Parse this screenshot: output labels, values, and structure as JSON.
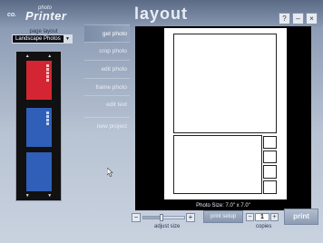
{
  "app": {
    "logo_brand": "co.",
    "logo_small": "photo",
    "logo_main": "Printer",
    "page_title": "layout"
  },
  "window_controls": {
    "help": "?",
    "minimize": "–",
    "close": "×"
  },
  "left_panel": {
    "label": "page layout",
    "select_value": "Landscape Photos",
    "select_arrow": "▼",
    "scroll_up": "▲",
    "scroll_down": "▼",
    "thumbnails": [
      {
        "color": "#d42632",
        "selected": false
      },
      {
        "color": "#2f5fb8",
        "selected": false
      },
      {
        "color": "#2f5fb8",
        "selected": false
      }
    ]
  },
  "menu": {
    "items": [
      {
        "label": "get photo"
      },
      {
        "label": "crop photo"
      },
      {
        "label": "edit photo"
      },
      {
        "label": "frame photo"
      },
      {
        "label": "edit text"
      },
      {
        "label": "new project"
      }
    ]
  },
  "preview": {
    "photo_size": "Photo Size: 7.0\" x 7.0\""
  },
  "bottom": {
    "zoom_label": "adjust size",
    "zoom_minus": "−",
    "zoom_plus": "+",
    "zoom_level": 0.45,
    "print_setup": "print setup",
    "copies_minus": "−",
    "copies_plus": "+",
    "copies_value": "1",
    "copies_label": "copies",
    "print": "print"
  }
}
